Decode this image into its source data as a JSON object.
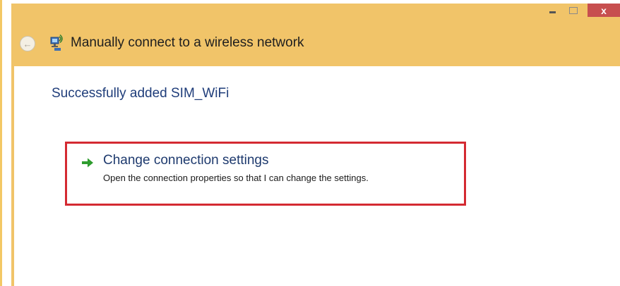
{
  "window": {
    "controls": {
      "minimize_icon": "minimize-icon",
      "maximize_icon": "maximize-icon",
      "close_glyph": "x"
    },
    "colors": {
      "frame": "#f1c469",
      "close": "#c74f4f",
      "highlight_border": "#d42a32",
      "link_text": "#1e3a6e"
    }
  },
  "navbar": {
    "back_icon": "back-arrow-icon",
    "network_icon": "wireless-network-icon",
    "title": "Manually connect to a wireless network"
  },
  "content": {
    "heading": "Successfully added SIM_WiFi",
    "option": {
      "icon": "green-arrow-icon",
      "title": "Change connection settings",
      "description": "Open the connection properties so that I can change the settings."
    }
  }
}
